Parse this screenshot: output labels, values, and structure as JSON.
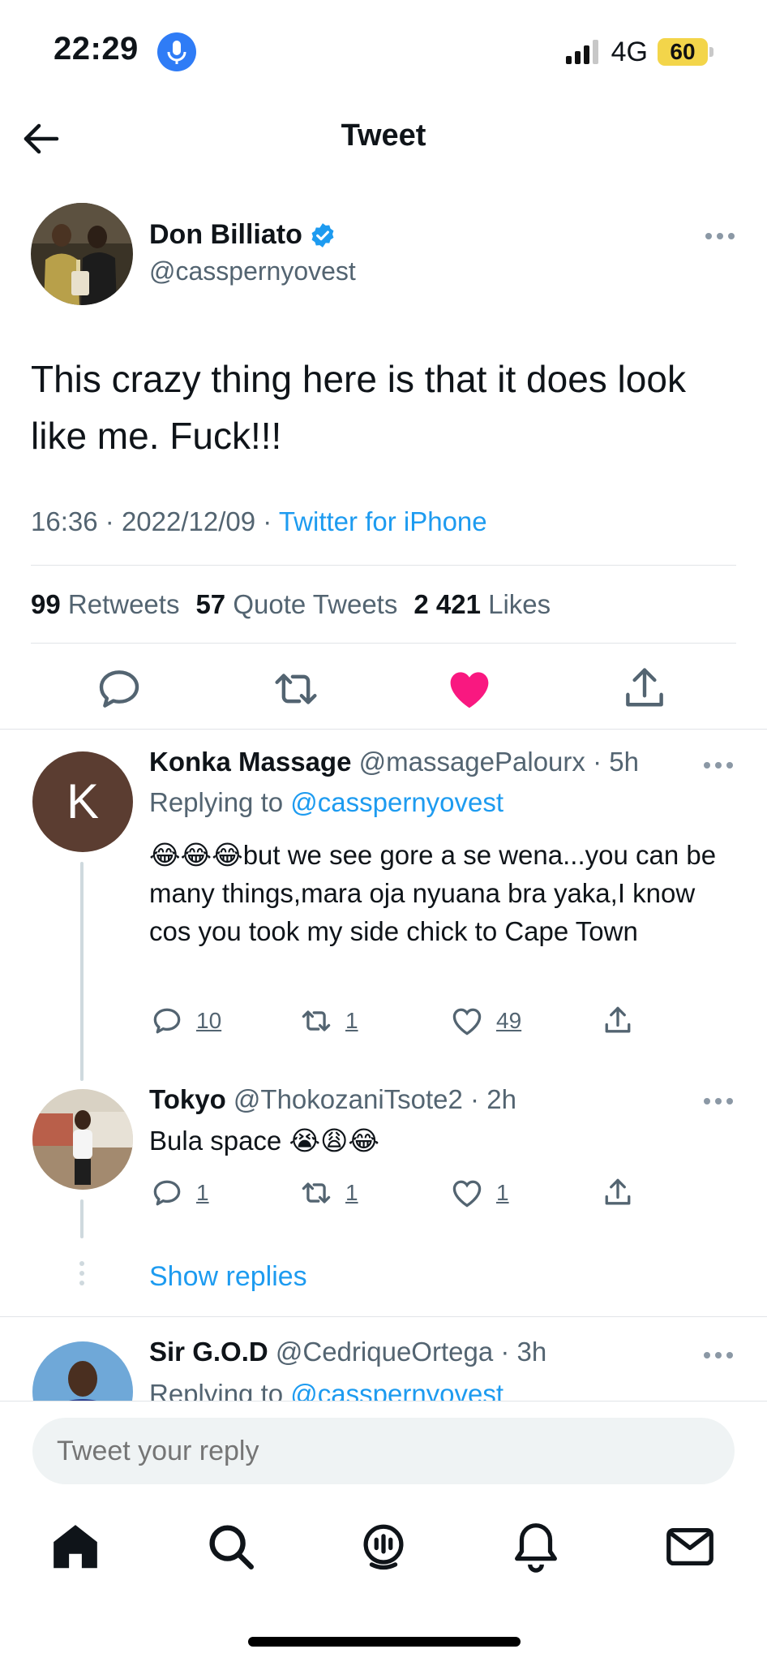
{
  "status_bar": {
    "time": "22:29",
    "network": "4G",
    "battery": "60"
  },
  "header": {
    "title": "Tweet"
  },
  "tweet": {
    "name": "Don Billiato",
    "handle": "@cassperny​ovest",
    "text": "This crazy thing here is that it does look like me. Fuck!!!",
    "time": "16:36",
    "date": "2022/12/09",
    "source": "Twitter for iPhone",
    "retweets_count": "99",
    "retweets_label": "Retweets",
    "quotes_count": "57",
    "quotes_label": "Quote Tweets",
    "likes_count": "2 421",
    "likes_label": "Likes"
  },
  "replies": [
    {
      "name": "Konka Massage",
      "handle": "@massagePalourx",
      "time": "5h",
      "avatar_letter": "K",
      "replying_prefix": "Replying to",
      "replying_to": "@casspernyovest",
      "emoji": "😂😂😂",
      "text": "but we see gore a se wena...you can be many things,mara oja nyuana bra yaka,I know cos you took my side chick to Cape Town",
      "reply_count": "10",
      "retweet_count": "1",
      "like_count": "49"
    },
    {
      "name": "Tokyo",
      "handle": "@ThokozaniTsote2",
      "time": "2h",
      "text": "Bula space",
      "emoji": "😭😩😂",
      "reply_count": "1",
      "retweet_count": "1",
      "like_count": "1"
    },
    {
      "name": "Sir G.O.D",
      "handle": "@CedriqueOrtega",
      "time": "3h",
      "replying_prefix": "Replying to",
      "replying_to": "@casspernyovest"
    }
  ],
  "show_replies": "Show replies",
  "reply_box": {
    "placeholder": "Tweet your reply"
  },
  "colors": {
    "accent": "#1d9bf0",
    "like": "#f91880",
    "text": "#0f1419",
    "muted": "#536471"
  },
  "icons": [
    "back-arrow-icon",
    "verified-icon",
    "more-icon",
    "reply-icon",
    "retweet-icon",
    "like-icon",
    "share-icon",
    "home-icon",
    "search-icon",
    "spaces-icon",
    "notifications-icon",
    "messages-icon"
  ]
}
